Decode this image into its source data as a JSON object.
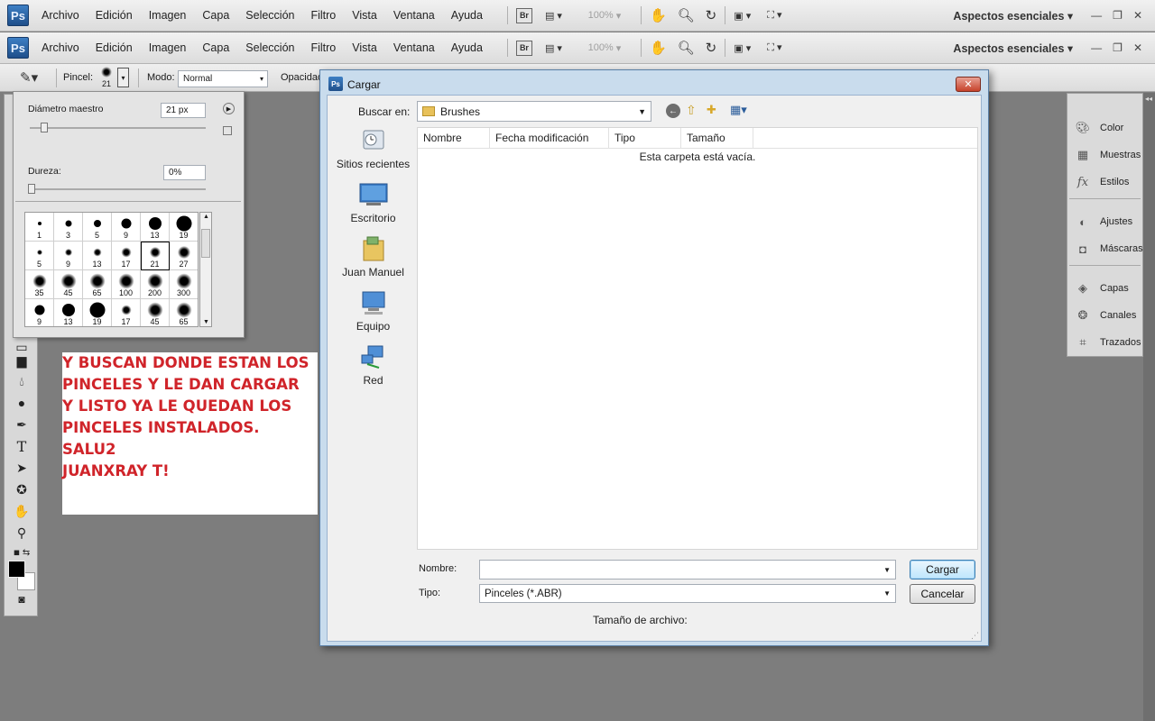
{
  "app": {
    "logo": "Ps",
    "workspace": "Aspectos esenciales",
    "zoom": "100%",
    "bridge": "Br"
  },
  "menu": [
    "Archivo",
    "Edición",
    "Imagen",
    "Capa",
    "Selección",
    "Filtro",
    "Vista",
    "Ventana",
    "Ayuda"
  ],
  "options": {
    "pincel_label": "Pincel:",
    "pincel_size": "21",
    "modo_label": "Modo:",
    "modo_value": "Normal",
    "opacidad_label": "Opacidad"
  },
  "brush_panel": {
    "diametro_label": "Diámetro maestro",
    "diametro_value": "21 px",
    "diametro_fraction": 0.08,
    "dureza_label": "Dureza:",
    "dureza_value": "0%",
    "dureza_fraction": 0.0,
    "brushes": [
      {
        "n": "1",
        "hard": true
      },
      {
        "n": "3",
        "hard": true
      },
      {
        "n": "5",
        "hard": true
      },
      {
        "n": "9",
        "hard": true
      },
      {
        "n": "13",
        "hard": true
      },
      {
        "n": "19",
        "hard": true
      },
      {
        "n": "5",
        "hard": false
      },
      {
        "n": "9",
        "hard": false
      },
      {
        "n": "13",
        "hard": false
      },
      {
        "n": "17",
        "hard": false
      },
      {
        "n": "21",
        "hard": false,
        "selected": true
      },
      {
        "n": "27",
        "hard": false
      },
      {
        "n": "35",
        "hard": false
      },
      {
        "n": "45",
        "hard": false
      },
      {
        "n": "65",
        "hard": false
      },
      {
        "n": "100",
        "hard": false
      },
      {
        "n": "200",
        "hard": false
      },
      {
        "n": "300",
        "hard": false
      },
      {
        "n": "9",
        "hard": true
      },
      {
        "n": "13",
        "hard": true
      },
      {
        "n": "19",
        "hard": true
      },
      {
        "n": "17",
        "hard": false
      },
      {
        "n": "45",
        "hard": false
      },
      {
        "n": "65",
        "hard": false
      }
    ]
  },
  "note_lines": [
    "Y BUSCAN DONDE ESTAN LOS",
    "PINCELES Y LE DAN CARGAR",
    "Y LISTO YA LE QUEDAN LOS",
    "PINCELES INSTALADOS.",
    "SALU2",
    "JUANXRAY T!"
  ],
  "panels": {
    "group1": [
      "Color",
      "Muestras",
      "Estilos"
    ],
    "group2": [
      "Ajustes",
      "Máscaras"
    ],
    "group3": [
      "Capas",
      "Canales",
      "Trazados"
    ]
  },
  "dialog": {
    "title": "Cargar",
    "logo": "Ps",
    "buscar_label": "Buscar en:",
    "folder": "Brushes",
    "places": [
      "Sitios recientes",
      "Escritorio",
      "Juan Manuel",
      "Equipo",
      "Red"
    ],
    "columns": [
      "Nombre",
      "Fecha modificación",
      "Tipo",
      "Tamaño"
    ],
    "empty_msg": "Esta carpeta está vacía.",
    "nombre_label": "Nombre:",
    "nombre_value": "",
    "tipo_label": "Tipo:",
    "tipo_value": "Pinceles (*.ABR)",
    "size_label": "Tamaño de archivo:",
    "btn_ok": "Cargar",
    "btn_cancel": "Cancelar"
  }
}
